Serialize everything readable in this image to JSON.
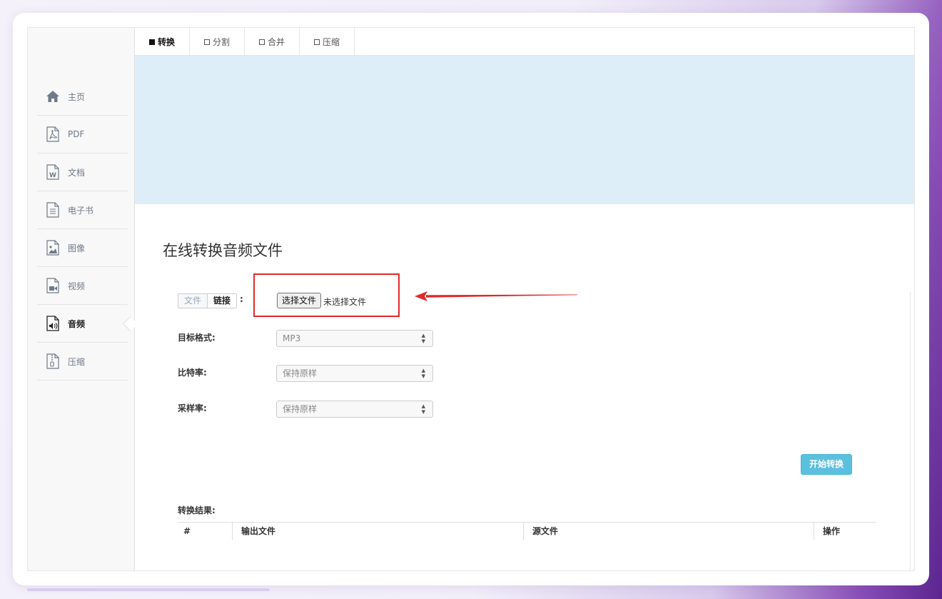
{
  "sidebar": {
    "items": [
      {
        "label": "主页",
        "icon": "home-icon",
        "active": false
      },
      {
        "label": "PDF",
        "icon": "pdf-icon",
        "active": false
      },
      {
        "label": "文档",
        "icon": "word-doc-icon",
        "active": false
      },
      {
        "label": "电子书",
        "icon": "ebook-icon",
        "active": false
      },
      {
        "label": "图像",
        "icon": "image-icon",
        "active": false
      },
      {
        "label": "视频",
        "icon": "video-icon",
        "active": false
      },
      {
        "label": "音频",
        "icon": "audio-icon",
        "active": true
      },
      {
        "label": "压缩",
        "icon": "zip-icon",
        "active": false
      }
    ]
  },
  "tabs": [
    {
      "label": "转换",
      "active": true
    },
    {
      "label": "分割",
      "active": false
    },
    {
      "label": "合并",
      "active": false
    },
    {
      "label": "压缩",
      "active": false
    }
  ],
  "main": {
    "title": "在线转换音频文件",
    "source_toggle": {
      "file": "文件",
      "link": "链接",
      "selected": "链接"
    },
    "colon": ":",
    "file_input": {
      "button": "选择文件",
      "status": "未选择文件"
    },
    "fields": {
      "target_format": {
        "label": "目标格式:",
        "value": "MP3"
      },
      "bitrate": {
        "label": "比特率:",
        "value": "保持原样"
      },
      "sample_rate": {
        "label": "采样率:",
        "value": "保持原样"
      }
    },
    "start_button": "开始转换",
    "results": {
      "label": "转换结果:",
      "columns": [
        "#",
        "输出文件",
        "源文件",
        "操作"
      ]
    }
  },
  "colors": {
    "banner": "#ddeef8",
    "highlight": "#e02a2a",
    "start_button": "#5bc0de"
  }
}
